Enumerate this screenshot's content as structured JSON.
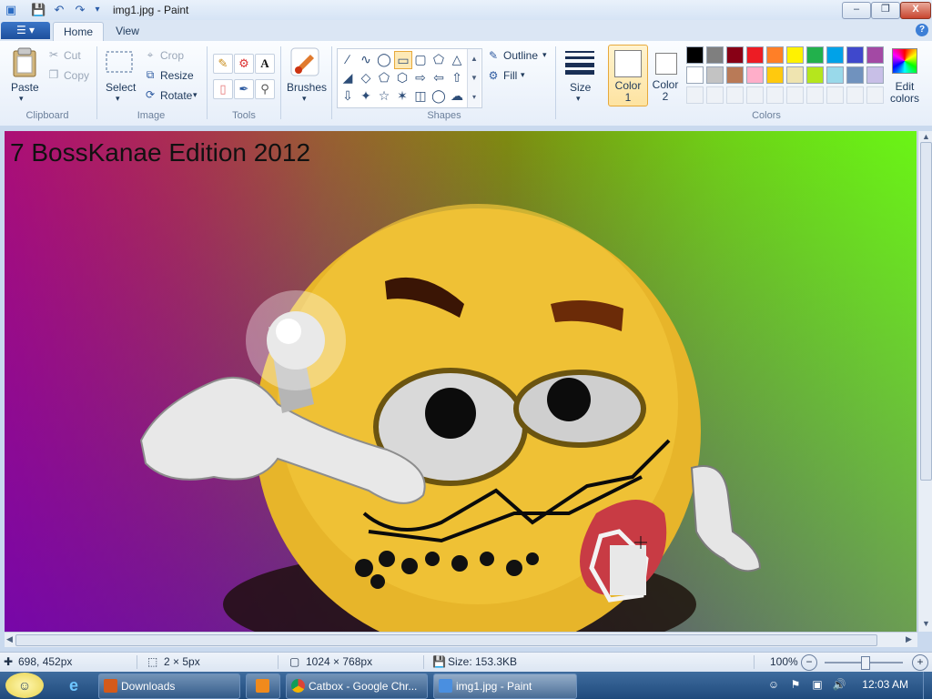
{
  "window": {
    "title": "img1.jpg - Paint",
    "controls": {
      "minimize": "–",
      "maximize": "❐",
      "close": "X"
    }
  },
  "tabs": {
    "file": "☰ ▾",
    "home": "Home",
    "view": "View",
    "help": "?"
  },
  "ribbon": {
    "clipboard": {
      "label": "Clipboard",
      "paste": "Paste",
      "cut": "Cut",
      "copy": "Copy"
    },
    "image": {
      "label": "Image",
      "select": "Select",
      "crop": "Crop",
      "resize": "Resize",
      "rotate": "Rotate"
    },
    "tools": {
      "label": "Tools",
      "text_tool": "A"
    },
    "brushes": {
      "label": "Brushes"
    },
    "shapes": {
      "label": "Shapes",
      "outline": "Outline",
      "fill": "Fill"
    },
    "size": {
      "label": "Size"
    },
    "colors": {
      "label": "Colors",
      "color1": "Color 1",
      "color1_value": "#ffffff",
      "color2": "Color 2",
      "color2_value": "#ffffff",
      "edit": "Edit colors",
      "palette_row1": [
        "#000000",
        "#7f7f7f",
        "#880015",
        "#ed1c24",
        "#ff7f27",
        "#fff200",
        "#22b14c",
        "#00a2e8",
        "#3f48cc",
        "#a349a4"
      ],
      "palette_row2": [
        "#ffffff",
        "#c3c3c3",
        "#b97a57",
        "#ffaec9",
        "#ffc90e",
        "#efe4b0",
        "#b5e61d",
        "#99d9ea",
        "#7092be",
        "#c8bfe7"
      ]
    }
  },
  "canvas": {
    "text": "7 BossKanae Edition 2012"
  },
  "status": {
    "cursor": "698, 452px",
    "selection": "2 × 5px",
    "image_size": "1024 × 768px",
    "file_size": "Size: 153.3KB",
    "zoom": "100%"
  },
  "taskbar": {
    "downloads": "Downloads",
    "chrome": "Catbox - Google Chr...",
    "paint": "img1.jpg - Paint",
    "clock": "12:03 AM"
  }
}
